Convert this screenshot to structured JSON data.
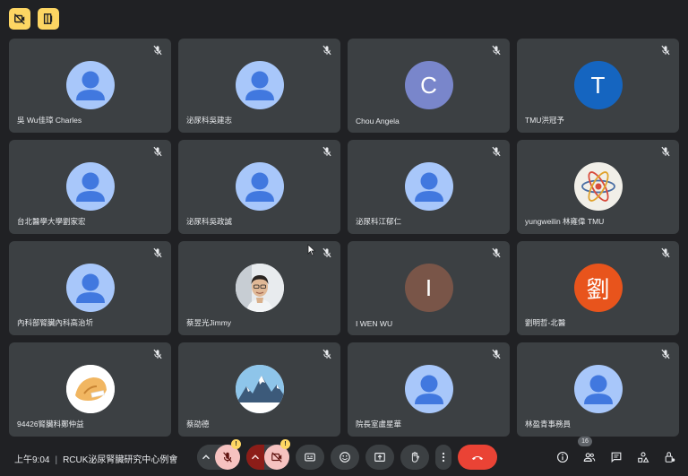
{
  "top_bar": {
    "buttons": [
      "hide-self-icon",
      "leave-layout-icon"
    ]
  },
  "participants": [
    {
      "name": "吳 Wu佳璋 Charles",
      "avatar": "default"
    },
    {
      "name": "泌尿科吳建志",
      "avatar": "default"
    },
    {
      "name": "Chou Angela",
      "avatar": "letter",
      "letter": "C",
      "color": "#7986cb"
    },
    {
      "name": "TMU洪冠予",
      "avatar": "letter",
      "letter": "T",
      "color": "#1565c0"
    },
    {
      "name": "台北醫學大學劉家宏",
      "avatar": "default"
    },
    {
      "name": "泌尿科吳政誠",
      "avatar": "default"
    },
    {
      "name": "泌尿科江郁仁",
      "avatar": "default"
    },
    {
      "name": "yungweilin 林雍偉 TMU",
      "avatar": "atom",
      "color": "#f1efe8"
    },
    {
      "name": "內科部腎臟內科高治圻",
      "avatar": "default"
    },
    {
      "name": "蔡昱光Jimmy",
      "avatar": "photo",
      "color": "#eceff1"
    },
    {
      "name": "I WEN WU",
      "avatar": "letter",
      "letter": "I",
      "color": "#795548"
    },
    {
      "name": "劉明哲-北醫",
      "avatar": "letter",
      "letter": "劉",
      "color": "#e8541c"
    },
    {
      "name": "94426腎臟科鄭仲益",
      "avatar": "cookie",
      "color": "#ffffff"
    },
    {
      "name": "蔡劭德",
      "avatar": "mountain",
      "color": "#d9ecf7"
    },
    {
      "name": "院長室盧星華",
      "avatar": "default"
    },
    {
      "name": "林盈青事務員",
      "avatar": "default"
    }
  ],
  "meeting": {
    "time": "上午9:04",
    "separator": "|",
    "title": "RCUK泌尿腎臟研究中心例會"
  },
  "controls": {
    "mic_badge": "!",
    "cam_badge": "!",
    "colors": {
      "mic_bg": "#f6c2c0",
      "cam_bg": "#f6c2c0",
      "cam_chevron_bg": "#8c1d18",
      "end_call": "#ea4335",
      "badge": "#fdd663"
    }
  },
  "people_count": "16",
  "icons": {
    "top": [
      "hide-self-icon",
      "layout-icon"
    ],
    "bottom_right": [
      "info-icon",
      "people-icon",
      "chat-icon",
      "activities-icon",
      "host-controls-icon"
    ]
  }
}
